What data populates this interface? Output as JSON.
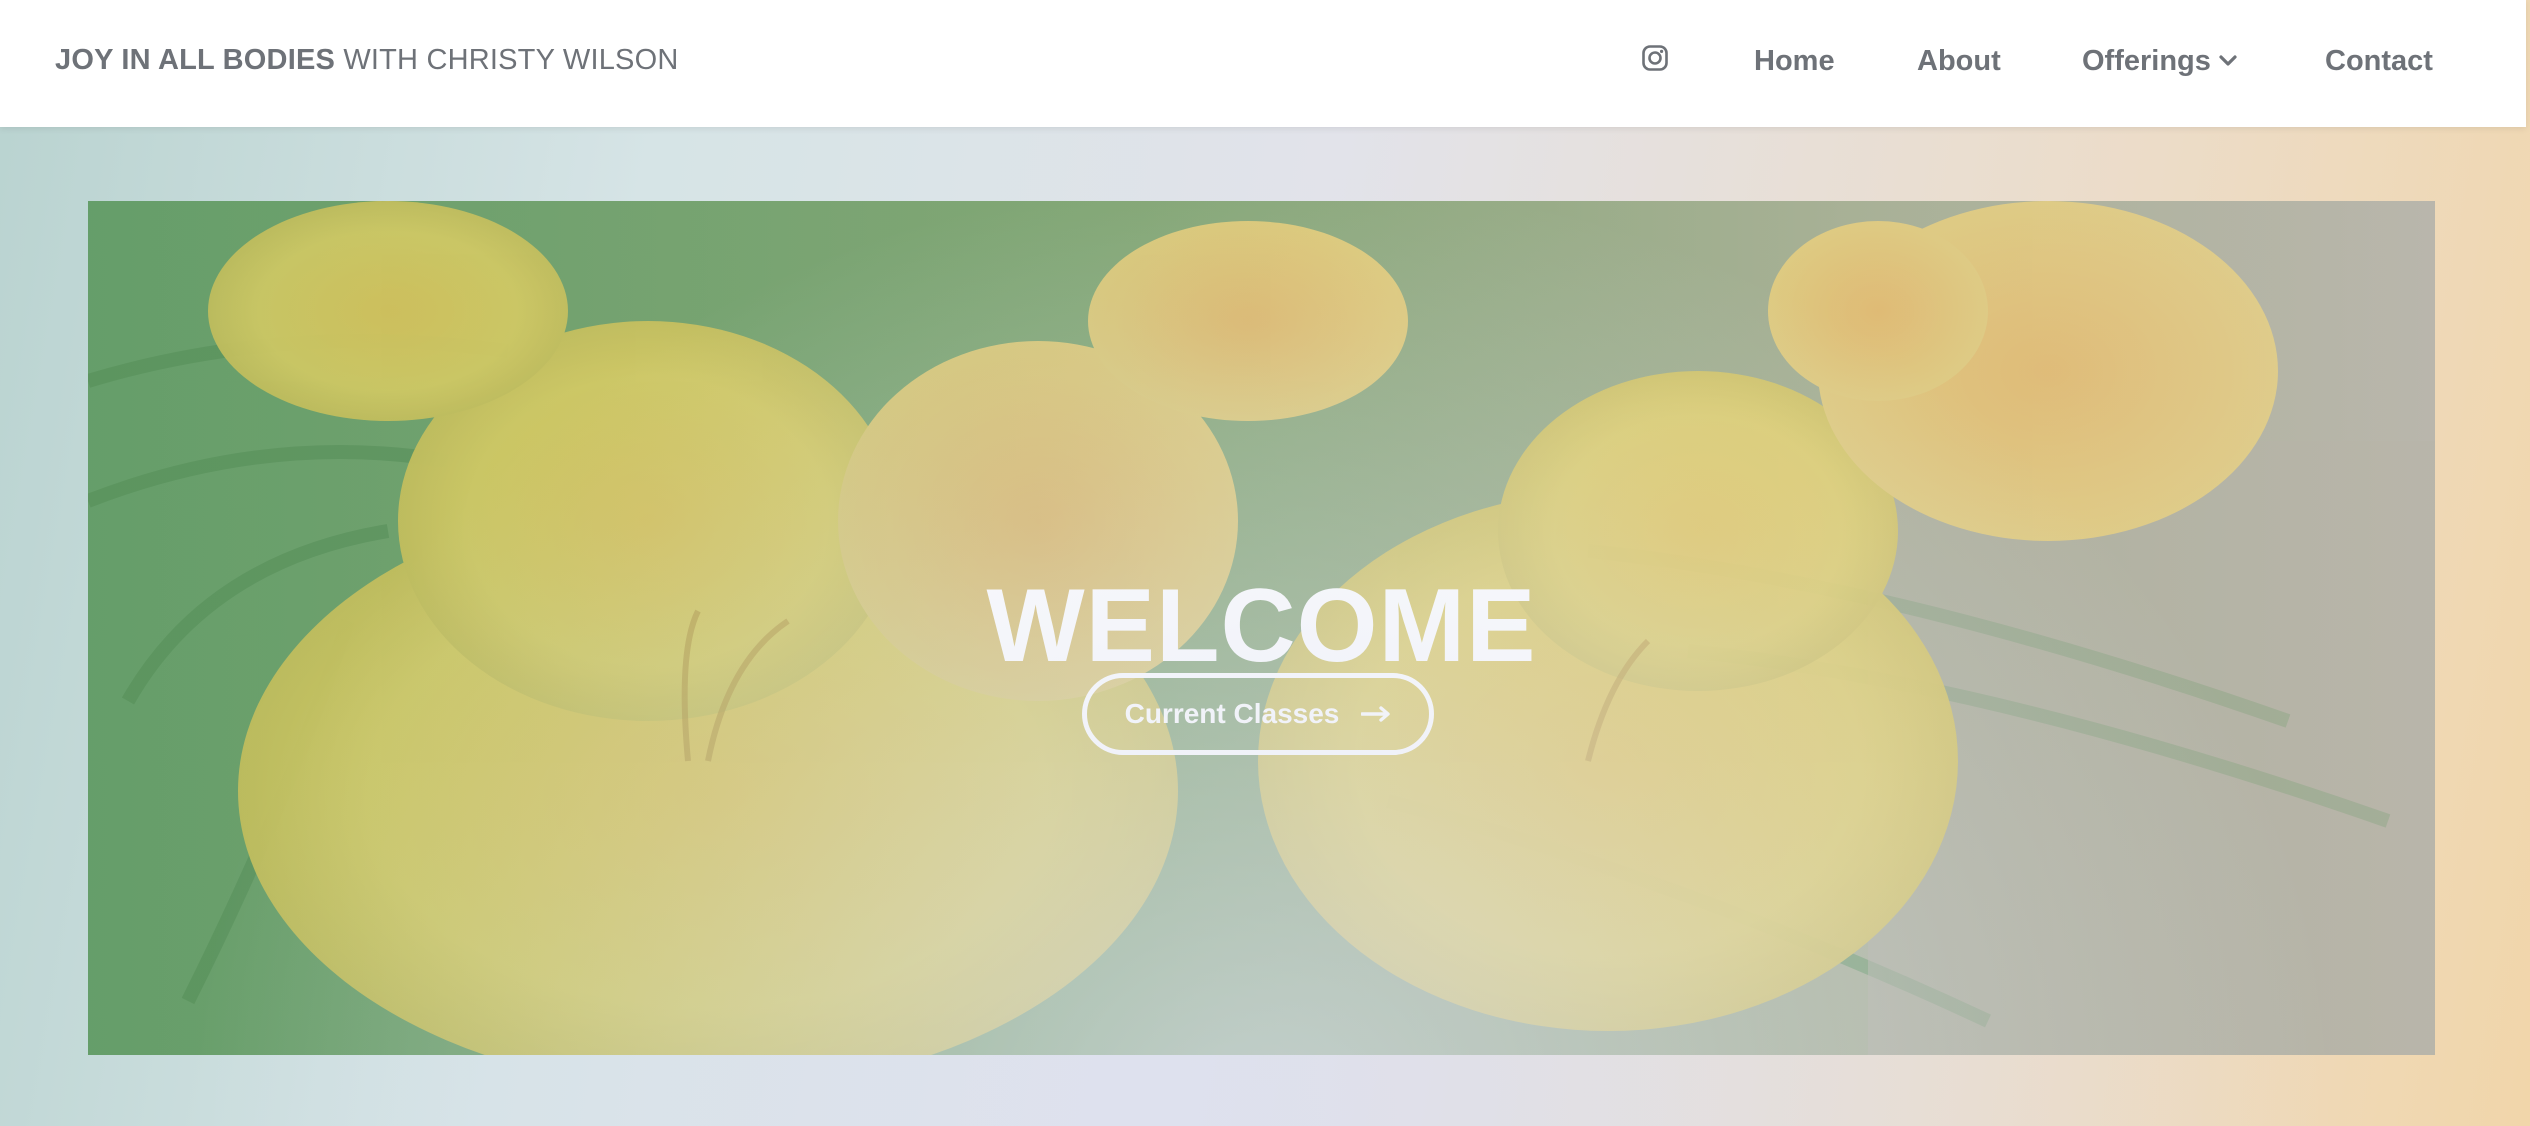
{
  "header": {
    "brand_bold": "JOY IN ALL BODIES",
    "brand_light": "WITH CHRISTY WILSON",
    "nav": {
      "instagram_icon": "instagram-icon",
      "home": "Home",
      "about": "About",
      "offerings": "Offerings",
      "offerings_icon": "chevron-down-icon",
      "contact": "Contact"
    }
  },
  "hero": {
    "title": "WELCOME",
    "button_label": "Current Classes",
    "button_icon": "arrow-right-icon"
  },
  "colors": {
    "nav_text": "#6e7278",
    "header_bg": "#ffffff",
    "hero_text": "#ffffff"
  }
}
